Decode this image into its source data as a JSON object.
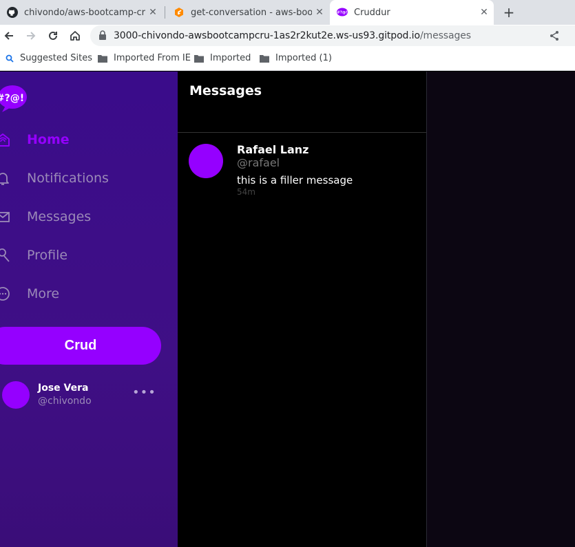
{
  "browser": {
    "tabs": [
      {
        "title": "chivondo/aws-bootcamp-crud",
        "favicon": "github-icon"
      },
      {
        "title": "get-conversation - aws-bootca",
        "favicon": "gitpod-icon"
      },
      {
        "title": "Cruddur",
        "favicon": "cruddur-icon"
      }
    ],
    "active_tab": 2,
    "tab_close_glyph": "✕",
    "new_tab_glyph": "+",
    "url_host": "3000-chivondo-awsbootcampcru-1as2r2kut2e.ws-us93.gitpod.io",
    "url_path": "/messages",
    "bookmarks": [
      {
        "label": "Suggested Sites",
        "icon": "search-icon"
      },
      {
        "label": "Imported From IE",
        "icon": "folder-icon"
      },
      {
        "label": "Imported",
        "icon": "folder-icon"
      },
      {
        "label": "Imported (1)",
        "icon": "folder-icon"
      }
    ]
  },
  "app": {
    "logo_text": "#?@!",
    "nav": [
      {
        "label": "Home",
        "icon": "home-icon",
        "active": true
      },
      {
        "label": "Notifications",
        "icon": "bell-icon",
        "active": false
      },
      {
        "label": "Messages",
        "icon": "envelope-icon",
        "active": false
      },
      {
        "label": "Profile",
        "icon": "person-icon",
        "active": false
      },
      {
        "label": "More",
        "icon": "more-circle-icon",
        "active": false
      }
    ],
    "crud_button": "Crud",
    "user": {
      "name": "Jose Vera",
      "handle": "@chivondo",
      "more": "•••"
    },
    "page_title": "Messages",
    "messages": [
      {
        "name": "Rafael Lanz",
        "handle": "@rafael",
        "text": "this is a filler message",
        "time": "54m"
      }
    ],
    "colors": {
      "accent": "#9500ff",
      "sidebar": "#3d0e85",
      "background": "#000000"
    }
  }
}
